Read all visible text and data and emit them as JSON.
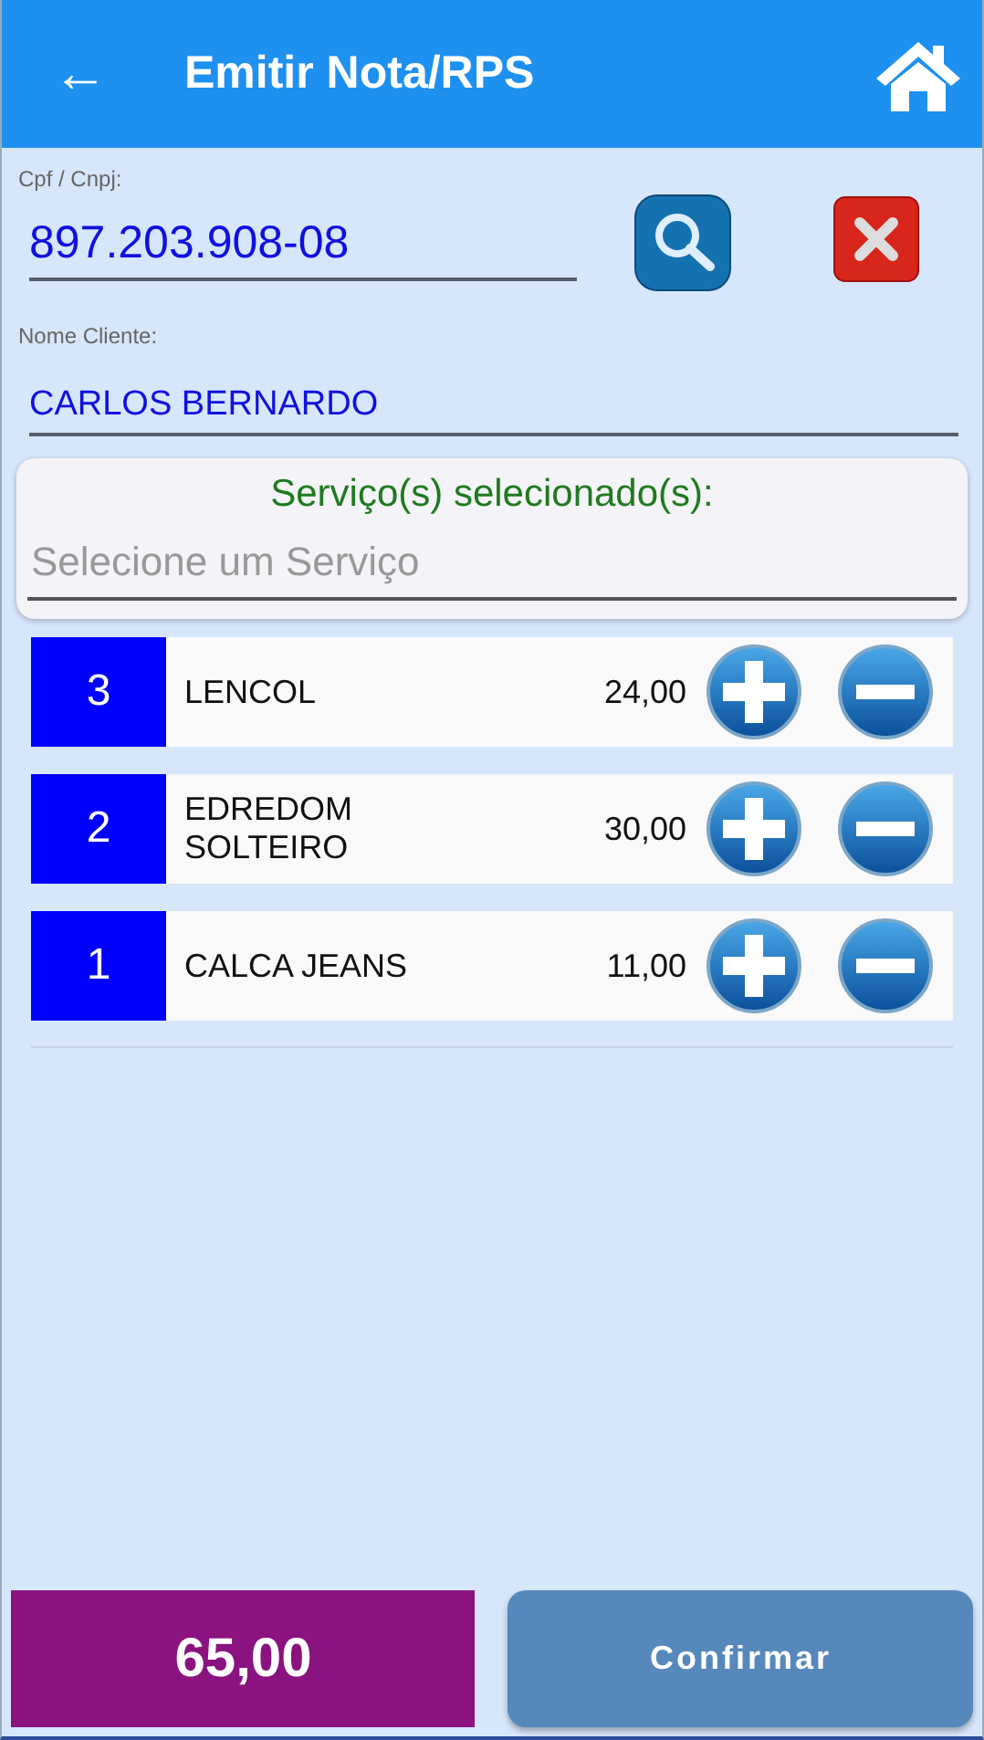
{
  "header": {
    "back": "←",
    "title": "Emitir Nota/RPS"
  },
  "cpf": {
    "label": "Cpf / Cnpj:",
    "value": "897.203.908-08"
  },
  "cliente": {
    "label": "Nome Cliente:",
    "value": "CARLOS BERNARDO"
  },
  "servicos": {
    "title": "Serviço(s) selecionado(s):",
    "placeholder": "Selecione um Serviço"
  },
  "items": [
    {
      "qty": "3",
      "name": "LENCOL",
      "price": "24,00"
    },
    {
      "qty": "2",
      "name": "EDREDOM SOLTEIRO",
      "price": "30,00"
    },
    {
      "qty": "1",
      "name": "CALCA JEANS",
      "price": "11,00"
    }
  ],
  "footer": {
    "total": "65,00",
    "confirm": "Confirmar"
  }
}
